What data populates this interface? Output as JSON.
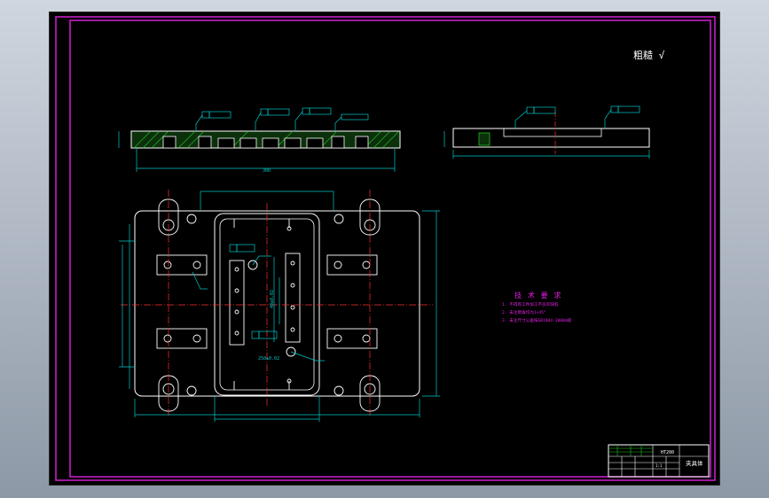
{
  "title_mark": "粗糙 √",
  "tech_requirements": {
    "heading": "技 术 要 求",
    "items": [
      "1. 不得有工件加工不良的缺陷",
      "2. 未注倒角均为1×45°",
      "3. 未注尺寸公差按GB1804-2000m级"
    ]
  },
  "title_block": {
    "scale": "1:1",
    "drawing_name": "夹具体",
    "code": "HT200"
  },
  "colors": {
    "frame": "#d020d0",
    "outline": "#ffffff",
    "dimension": "#00c8c8",
    "centerline": "#ff3030",
    "hatch": "#20c020",
    "tech": "#e020e0",
    "title": "#ffffff"
  }
}
